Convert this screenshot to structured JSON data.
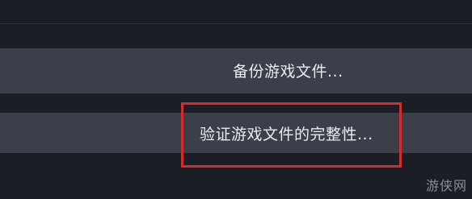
{
  "menu": {
    "items": [
      {
        "label": "备份游戏文件..."
      },
      {
        "label": "验证游戏文件的完整性..."
      }
    ]
  },
  "highlight": {
    "color": "#d52b2b"
  },
  "colors": {
    "background": "#1b1e25",
    "menu_item_bg": "#3a3f49",
    "text": "#e9ecef"
  },
  "watermark": {
    "text": "游侠网"
  }
}
